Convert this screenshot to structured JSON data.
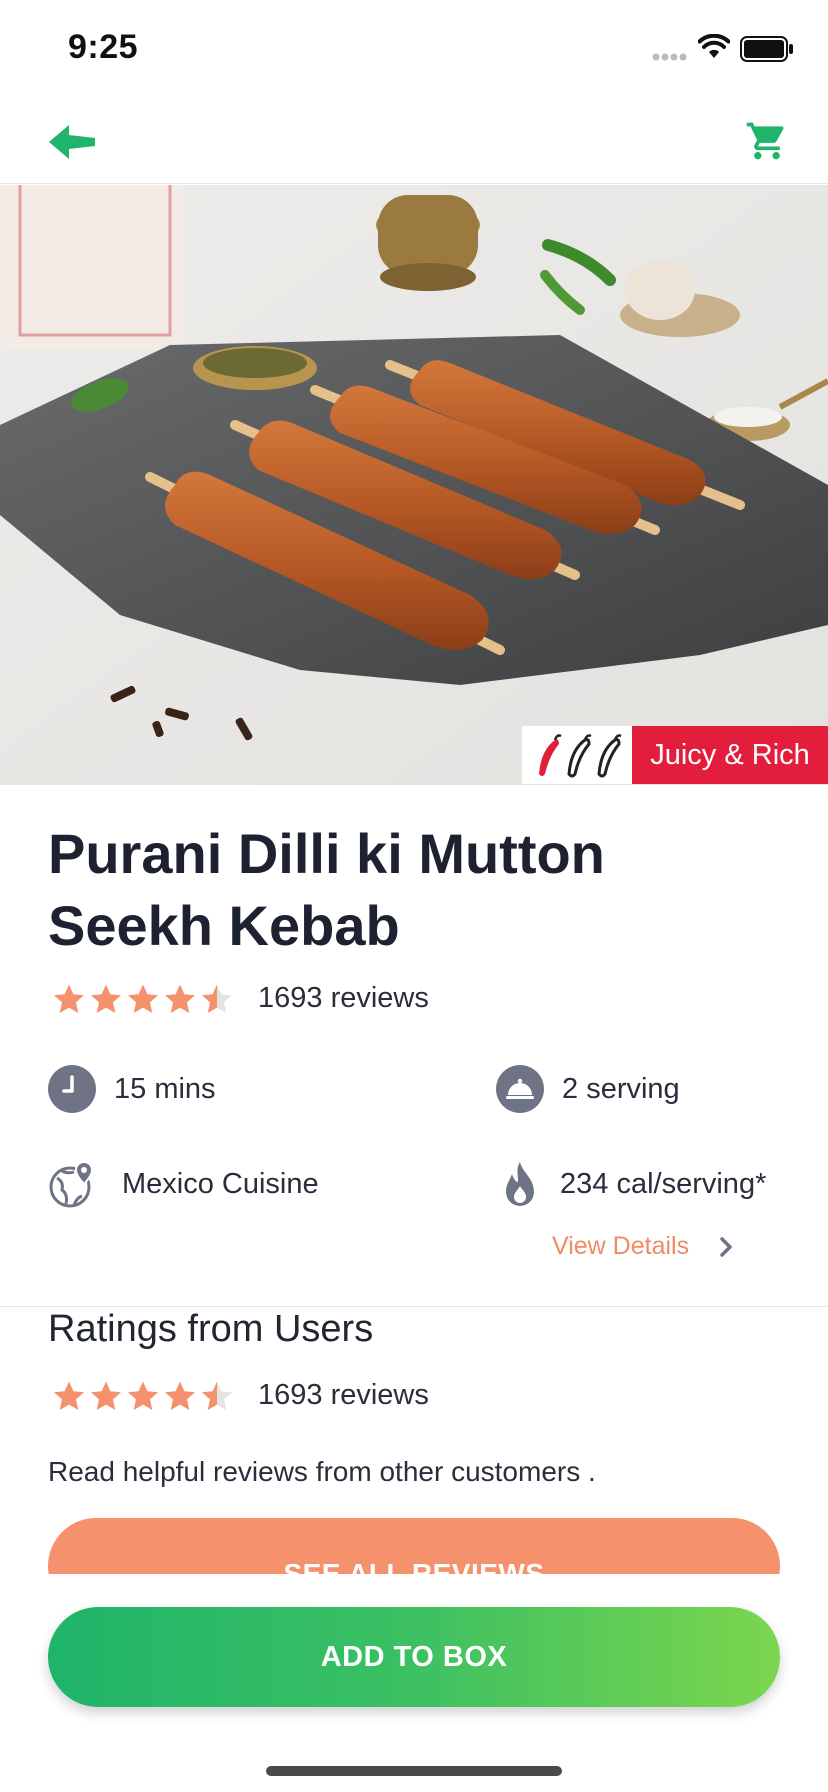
{
  "status": {
    "time": "9:25"
  },
  "product": {
    "title_line1": "Purani Dilli ki Mutton",
    "title_line2": "Seekh Kebab",
    "rating": 4.5,
    "review_count": "1693",
    "reviews_word": "reviews",
    "badge_label": "Juicy & Rich",
    "carousel": {
      "total": 3,
      "active": 1
    }
  },
  "details": {
    "time": {
      "value": "15",
      "unit": "mins",
      "icon": "clock-icon"
    },
    "serving": {
      "value": "2",
      "unit": "serving",
      "icon": "cloche-icon"
    },
    "cuisine": {
      "label": "Mexico Cuisine",
      "icon": "globe-pin-icon"
    },
    "calories": {
      "value": "234",
      "unit": "cal/serving*",
      "icon": "flame-icon"
    },
    "view_details_label": "View Details"
  },
  "ratings_section": {
    "title": "Ratings from Users",
    "rating": 4.5,
    "review_count": "1693",
    "reviews_word": "reviews",
    "helper_text": "Read helpful reviews from other customers .",
    "see_all_label": "SEE ALL REVIEWS"
  },
  "actions": {
    "add_to_box_label": "ADD TO BOX"
  },
  "colors": {
    "accent_green": "#1fb46a",
    "accent_orange": "#f5916c",
    "star": "#f5916c",
    "badge_red": "#e31e3c"
  }
}
